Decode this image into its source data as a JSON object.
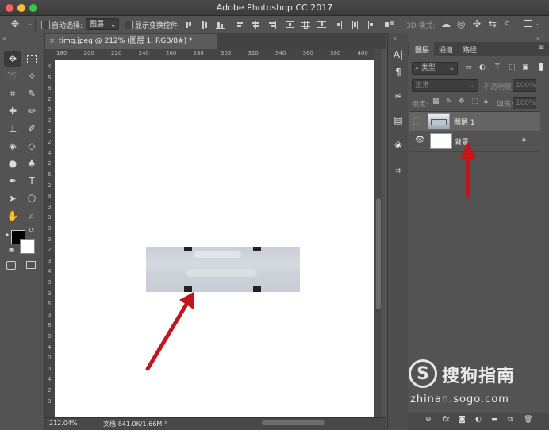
{
  "window": {
    "title": "Adobe Photoshop CC 2017",
    "traffic_colors": [
      "#fc605c",
      "#fdbc40",
      "#34c84a"
    ]
  },
  "options_bar": {
    "auto_select_label": "自动选择:",
    "auto_select_value": "图层",
    "show_transform_label": "显示变换控件",
    "mode_3d_label": "3D 模式:"
  },
  "document": {
    "tab_title": "timg.jpeg @ 212% (图层 1, RGB/8#) *",
    "zoom": "212.04%",
    "doc_info": "文档:841.0K/1.66M",
    "ruler_h": [
      "180",
      "200",
      "220",
      "240",
      "260",
      "280",
      "300",
      "320",
      "340",
      "360",
      "380",
      "400"
    ],
    "ruler_v": [
      "4",
      "6",
      "8",
      "2",
      "0",
      "2",
      "2",
      "2",
      "4",
      "2",
      "6",
      "2",
      "8",
      "3",
      "0",
      "0",
      "3",
      "2",
      "3",
      "4",
      "0",
      "3",
      "6",
      "3",
      "8",
      "0",
      "4",
      "0",
      "0",
      "4",
      "2",
      "0"
    ]
  },
  "panel": {
    "tabs": [
      "图层",
      "通道",
      "路径"
    ],
    "filter_label": "类型",
    "blend_mode": "正常",
    "opacity_label": "不透明度:",
    "opacity_value": "100%",
    "lock_label": "锁定:",
    "fill_label": "填充:",
    "fill_value": "100%",
    "layers": [
      {
        "name": "图层 1",
        "selected": true,
        "visible": false
      },
      {
        "name": "背景",
        "selected": false,
        "visible": true,
        "locked": true
      }
    ],
    "bottom_icons": [
      "link-icon",
      "fx-icon",
      "mask-icon",
      "adjustment-icon",
      "folder-icon",
      "new-layer-icon",
      "trash-icon"
    ],
    "bottom_fx": "fx"
  },
  "colors": {
    "foreground": "#000000",
    "background": "#ffffff",
    "arrow": "#c0161c",
    "selected_layer": "#646464"
  },
  "watermark": {
    "brand": "搜狗指南",
    "url": "zhinan.sogo.com"
  }
}
